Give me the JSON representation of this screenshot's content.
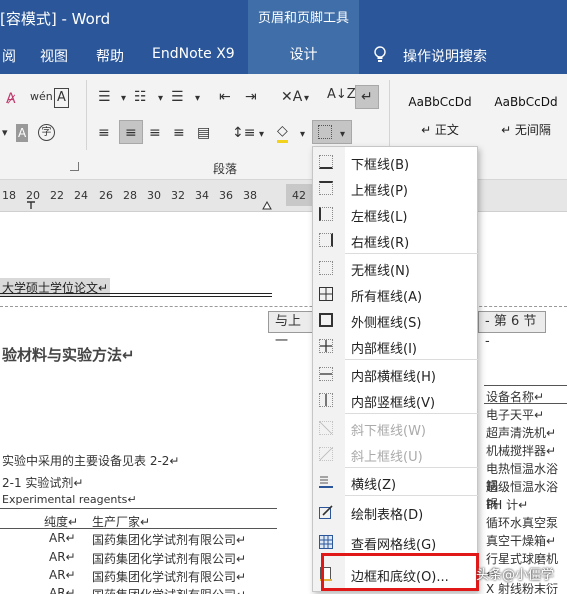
{
  "titlebar": {
    "window_title": "[容模式] - Word",
    "contextual_tools": "页眉和页脚工具"
  },
  "tabs": {
    "review": "阅",
    "view": "视图",
    "help": "帮助",
    "endnote": "EndNote X9",
    "design": "设计",
    "tell_me": "操作说明搜索"
  },
  "ribbon": {
    "paragraph_group": "段落",
    "styles": [
      {
        "sample": "AaBbCcDd",
        "name": "↵ 正文"
      },
      {
        "sample": "AaBbCcDd",
        "name": "↵ 无间隔"
      }
    ]
  },
  "ruler": {
    "numbers": [
      "18",
      "20",
      "22",
      "24",
      "26",
      "28",
      "30",
      "32",
      "34",
      "36",
      "38",
      "42"
    ]
  },
  "document": {
    "header_text": "大学硕士学位论文↵",
    "same_as_prev": "与上一",
    "section_tag": "- 第 6 节 -",
    "heading": "验材料与实验方法↵",
    "para1": "实验中采用的主要设备见表 2-2↵",
    "table_caption1": "2-1 实验试剂↵",
    "table_caption2": "Experimental reagents↵",
    "col_purity": "纯度↵",
    "col_maker": "生产厂家↵",
    "rows": [
      {
        "purity": "AR↵",
        "maker": "国药集团化学试剂有限公司↵"
      },
      {
        "purity": "AR↵",
        "maker": "国药集团化学试剂有限公司↵"
      },
      {
        "purity": "AR↵",
        "maker": "国药集团化学试剂有限公司↵"
      },
      {
        "purity": "AR↵",
        "maker": "国药集团化学试剂有限公司↵"
      }
    ],
    "equipment_header": "设备名称↵",
    "equipment": [
      "电子天平↵",
      "超声清洗机↵",
      "机械搅拌器↵",
      "电热恒温水浴锅",
      "超级恒温水浴锅",
      "PH 计↵",
      "循环水真空泵",
      "真空干燥箱↵",
      "行星式球磨机↵",
      "X 射线粉末衍射"
    ]
  },
  "menu": {
    "items": [
      {
        "label": "下框线(B)",
        "disabled": false
      },
      {
        "label": "上框线(P)",
        "disabled": false
      },
      {
        "label": "左框线(L)",
        "disabled": false
      },
      {
        "label": "右框线(R)",
        "disabled": false
      },
      {
        "label": "无框线(N)",
        "disabled": false
      },
      {
        "label": "所有框线(A)",
        "disabled": false
      },
      {
        "label": "外侧框线(S)",
        "disabled": false
      },
      {
        "label": "内部框线(I)",
        "disabled": false
      },
      {
        "label": "内部横框线(H)",
        "disabled": false
      },
      {
        "label": "内部竖框线(V)",
        "disabled": false
      },
      {
        "label": "斜下框线(W)",
        "disabled": true
      },
      {
        "label": "斜上框线(U)",
        "disabled": true
      },
      {
        "label": "横线(Z)",
        "disabled": false
      },
      {
        "label": "绘制表格(D)",
        "disabled": false
      },
      {
        "label": "查看网格线(G)",
        "disabled": false
      },
      {
        "label": "边框和底纹(O)...",
        "disabled": false
      }
    ]
  },
  "watermark": "头条@小僵学"
}
